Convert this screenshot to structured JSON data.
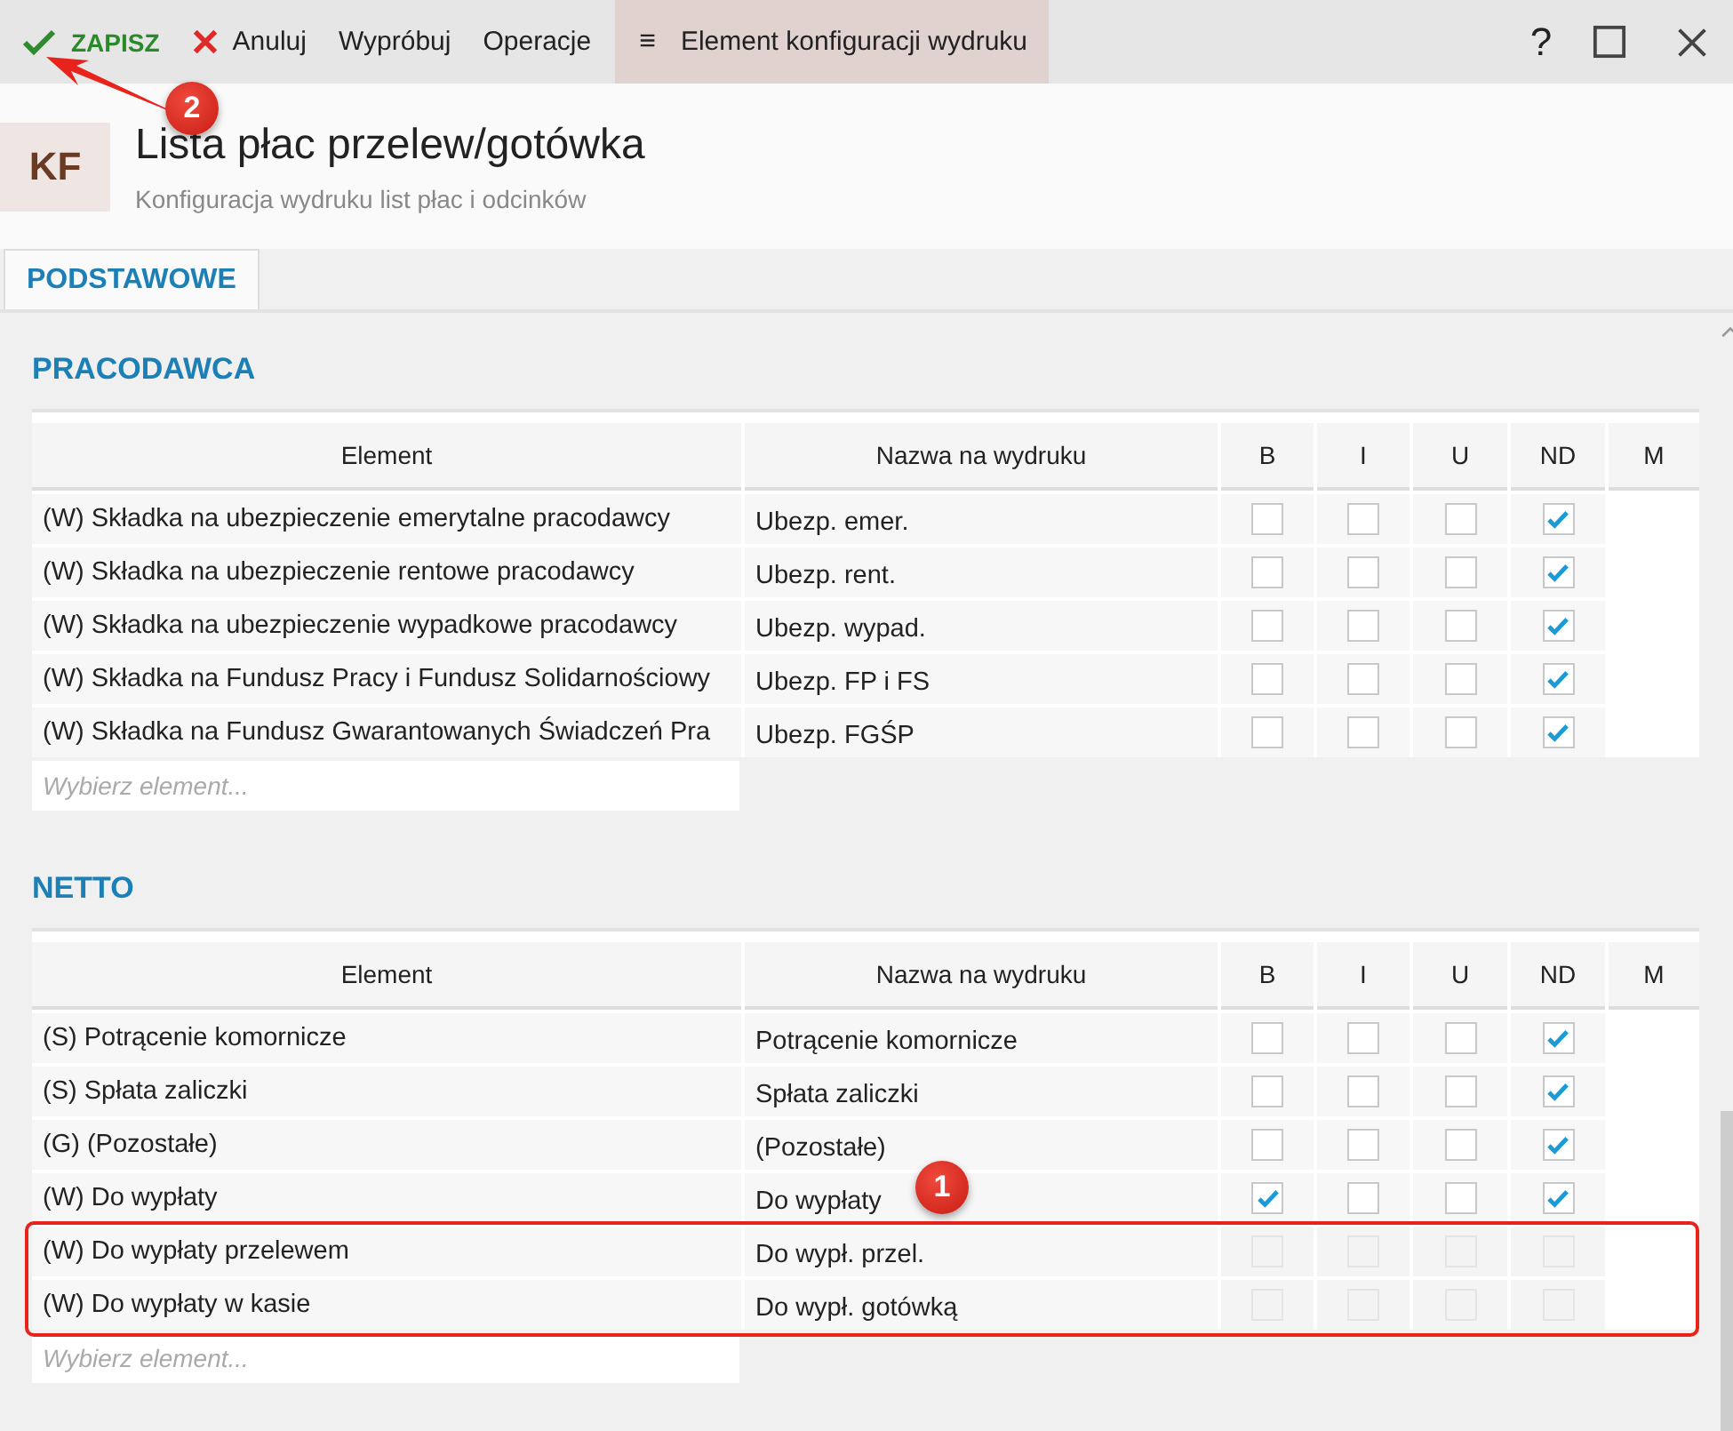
{
  "toolbar": {
    "save": "ZAPISZ",
    "cancel": "Anuluj",
    "try": "Wypróbuj",
    "operations": "Operacje",
    "menu_icon": "≡",
    "element_menu": "Element konfiguracji wydruku",
    "help": "?"
  },
  "header": {
    "badge": "KF",
    "title": "Lista płac przelew/gotówka",
    "subtitle": "Konfiguracja wydruku list płac i odcinków"
  },
  "tabs": [
    {
      "label": "PODSTAWOWE",
      "selected": true
    }
  ],
  "sections": [
    {
      "title": "PRACODAWCA",
      "columns": [
        "Element",
        "Nazwa na wydruku",
        "B",
        "I",
        "U",
        "ND",
        "M"
      ],
      "placeholder": "Wybierz element...",
      "rows": [
        {
          "element": "(W) Składka na ubezpieczenie emerytalne pracodawcy",
          "name": "Ubezp. emer.",
          "flags": [
            false,
            false,
            false,
            true
          ],
          "disabled": false
        },
        {
          "element": "(W) Składka na ubezpieczenie rentowe pracodawcy",
          "name": "Ubezp. rent.",
          "flags": [
            false,
            false,
            false,
            true
          ],
          "disabled": false
        },
        {
          "element": "(W) Składka na ubezpieczenie wypadkowe pracodawcy",
          "name": "Ubezp. wypad.",
          "flags": [
            false,
            false,
            false,
            true
          ],
          "disabled": false
        },
        {
          "element": "(W) Składka na Fundusz Pracy i Fundusz Solidarnościowy",
          "name": "Ubezp. FP i FS",
          "flags": [
            false,
            false,
            false,
            true
          ],
          "disabled": false
        },
        {
          "element": "(W) Składka na Fundusz Gwarantowanych Świadczeń Pra",
          "name": "Ubezp. FGŚP",
          "flags": [
            false,
            false,
            false,
            true
          ],
          "disabled": false
        }
      ]
    },
    {
      "title": "NETTO",
      "columns": [
        "Element",
        "Nazwa na wydruku",
        "B",
        "I",
        "U",
        "ND",
        "M"
      ],
      "placeholder": "Wybierz element...",
      "rows": [
        {
          "element": "(S) Potrącenie komornicze",
          "name": "Potrącenie komornicze",
          "flags": [
            false,
            false,
            false,
            true
          ],
          "disabled": false
        },
        {
          "element": "(S) Spłata zaliczki",
          "name": "Spłata zaliczki",
          "flags": [
            false,
            false,
            false,
            true
          ],
          "disabled": false
        },
        {
          "element": "(G) (Pozostałe)",
          "name": "(Pozostałe)",
          "flags": [
            false,
            false,
            false,
            true
          ],
          "disabled": false
        },
        {
          "element": "(W) Do wypłaty",
          "name": "Do wypłaty",
          "flags": [
            true,
            false,
            false,
            true
          ],
          "disabled": false
        },
        {
          "element": "(W) Do wypłaty przelewem",
          "name": "Do wypł. przel.",
          "flags": [
            false,
            false,
            false,
            false
          ],
          "disabled": true
        },
        {
          "element": "(W) Do wypłaty w kasie",
          "name": "Do wypł. gotówką",
          "flags": [
            false,
            false,
            false,
            false
          ],
          "disabled": true
        }
      ]
    }
  ],
  "annotations": [
    {
      "label": "1"
    },
    {
      "label": "2"
    }
  ]
}
